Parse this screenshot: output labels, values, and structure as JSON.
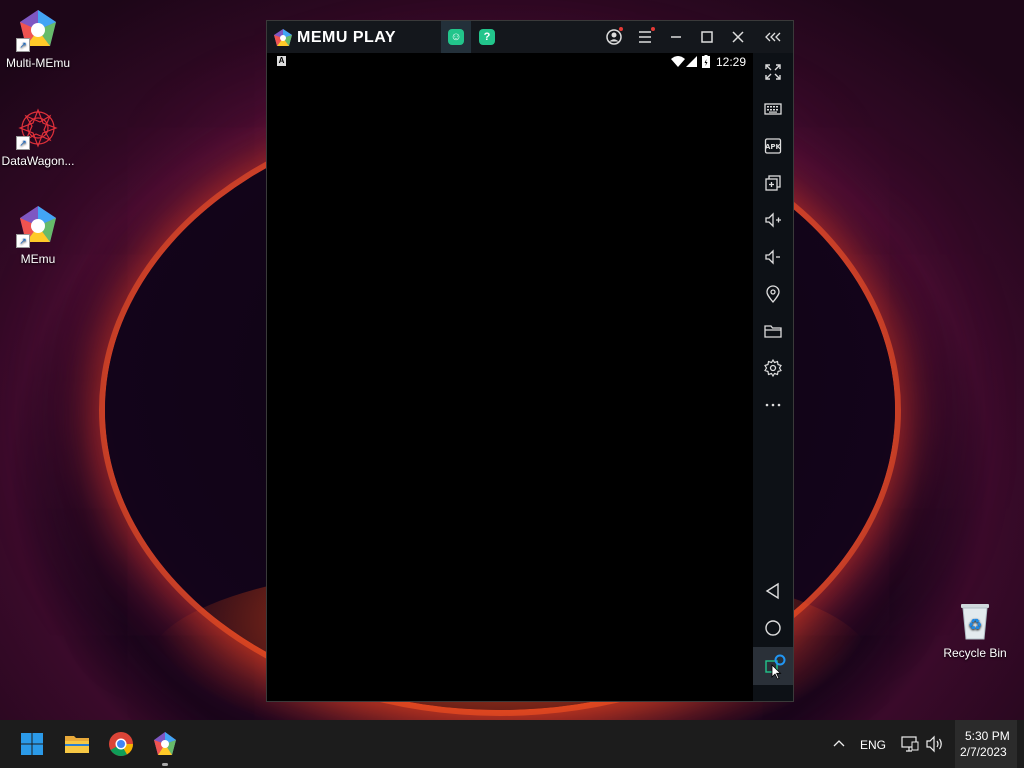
{
  "desktop": {
    "icons": [
      {
        "label": "Multi-MEmu"
      },
      {
        "label": "DataWagon..."
      },
      {
        "label": "MEmu"
      },
      {
        "label": "Recycle Bin"
      }
    ]
  },
  "emulator": {
    "logo_text": "MEMU PLAY",
    "tabs": [
      {
        "name": "app-tab-1",
        "glyph": "☺"
      },
      {
        "name": "app-tab-2",
        "glyph": "?"
      }
    ],
    "status": {
      "left_glyph": "A",
      "time": "12:29"
    },
    "sidebar_icons": [
      "fullscreen-icon",
      "keyboard-icon",
      "apk-icon",
      "multi-window-icon",
      "volume-up-icon",
      "volume-down-icon",
      "location-icon",
      "folder-icon",
      "settings-icon",
      "more-icon"
    ],
    "nav_icons": [
      "back-icon",
      "home-icon",
      "recents-icon"
    ],
    "apk_label": "APK"
  },
  "taskbar": {
    "language": "ENG",
    "time": "5:30 PM",
    "date": "2/7/2023"
  },
  "colors": {
    "accent_green": "#22c58b",
    "titlebar": "#14171c",
    "sidebar": "#0d1116",
    "taskbar": "#1c1c1c"
  }
}
